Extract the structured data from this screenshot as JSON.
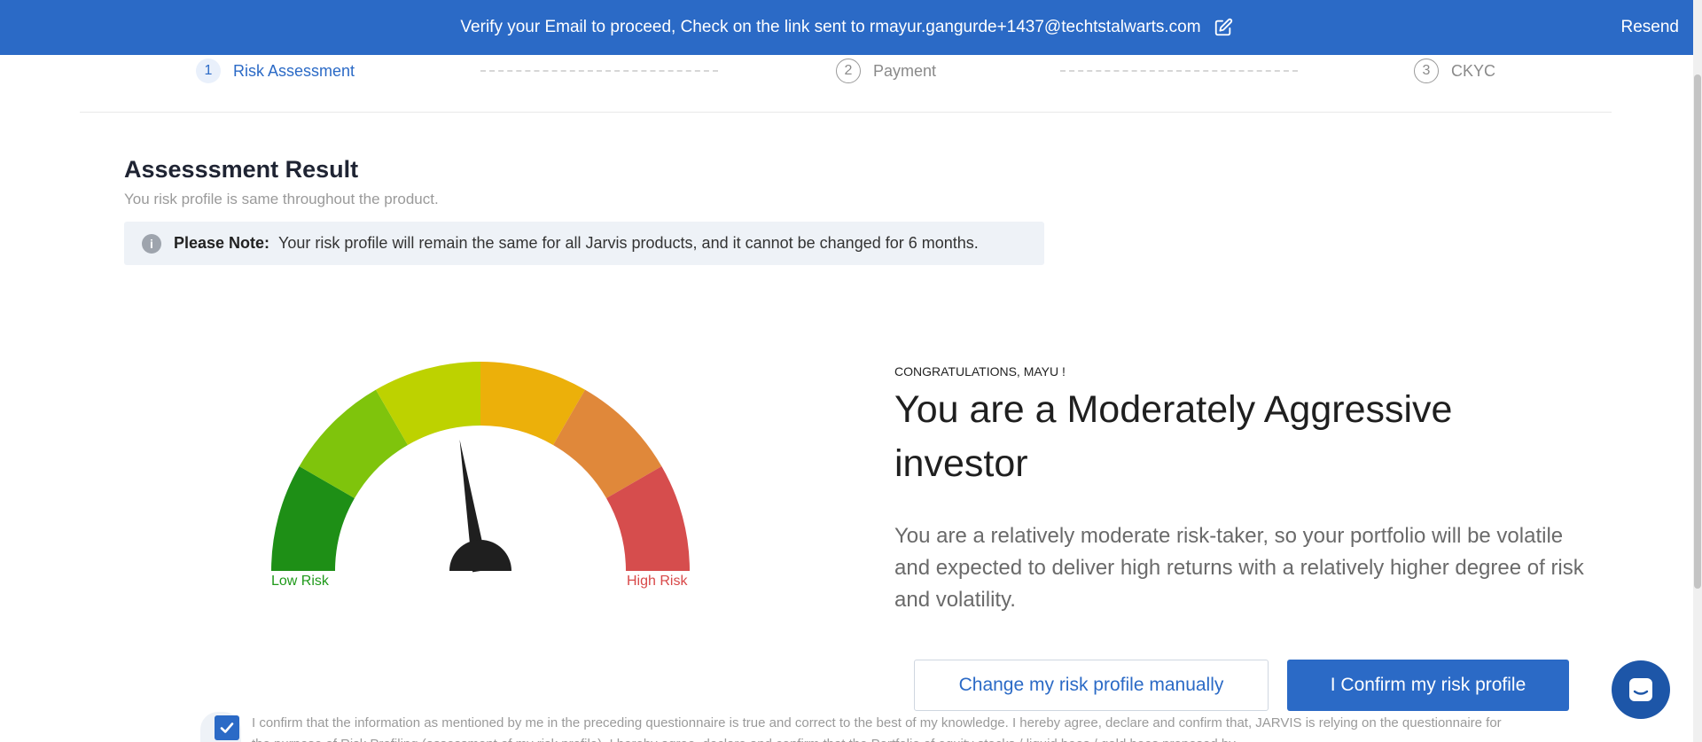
{
  "banner": {
    "message": "Verify your Email to proceed, Check on the link sent to rmayur.gangurde+1437@techtstalwarts.com",
    "resend_label": "Resend",
    "edit_icon": "edit-icon"
  },
  "stepper": {
    "steps": [
      {
        "number": "1",
        "label": "Risk Assessment",
        "active": true
      },
      {
        "number": "2",
        "label": "Payment",
        "active": false
      },
      {
        "number": "3",
        "label": "CKYC",
        "active": false
      }
    ]
  },
  "assessment": {
    "title": "Assesssment Result",
    "subtitle": "You risk profile is same throughout the product.",
    "note_label": "Please Note:",
    "note_text": "Your risk profile will remain the same for all Jarvis products, and it cannot be changed for 6 months."
  },
  "gauge": {
    "low_label": "Low Risk",
    "high_label": "High Risk",
    "segment_colors": [
      "#1e8f16",
      "#7fc40c",
      "#bdd200",
      "#ecb00a",
      "#e0883a",
      "#d64d4d"
    ],
    "needle_fraction": 0.45
  },
  "result": {
    "congrats": "CONGRATULATIONS, MAYU !",
    "headline": "You are a Moderately Aggressive investor",
    "description": "You are a relatively moderate risk-taker, so your portfolio will be volatile and expected to deliver high returns with a relatively higher degree of risk and volatility."
  },
  "actions": {
    "change_label": "Change my risk profile manually",
    "confirm_label": "I Confirm my risk profile"
  },
  "consent": {
    "checked": true,
    "text": "I confirm that the information as mentioned by me in the preceding questionnaire is true and correct to the best of my knowledge. I hereby agree, declare and confirm that, JARVIS is relying on the questionnaire for the purpose of Risk Profiling (assessment of my risk profile). I hereby agree, declare and confirm that the Portfolio of equity stocks / liquid bees / gold bees proposed by"
  },
  "colors": {
    "accent": "#2b6ac6",
    "low": "#1f9a1a",
    "high": "#d84848"
  }
}
